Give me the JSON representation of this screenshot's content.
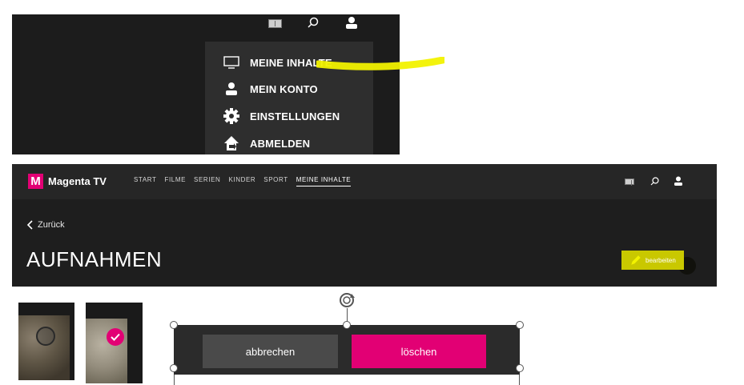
{
  "dropdown_panel": {
    "header_icons": [
      "language-flag-icon",
      "search-icon",
      "user-icon"
    ],
    "menu": [
      {
        "label": "MEINE INHALTE",
        "icon": "tv-icon"
      },
      {
        "label": "MEIN KONTO",
        "icon": "user-icon"
      },
      {
        "label": "EINSTELLUNGEN",
        "icon": "gear-icon"
      },
      {
        "label": "ABMELDEN",
        "icon": "home-logout-icon"
      }
    ],
    "highlight_color": "#f2f200"
  },
  "header": {
    "logo_letter": "M",
    "brand": "Magenta TV",
    "nav": [
      "START",
      "FILME",
      "SERIEN",
      "KINDER",
      "SPORT",
      "MEINE INHALTE"
    ],
    "active_nav": "MEINE INHALTE",
    "icons": [
      "language-flag-icon",
      "search-icon",
      "user-icon"
    ]
  },
  "page": {
    "back_label": "Zurück",
    "title": "AUFNAHMEN",
    "edit_label": "bearbeiten"
  },
  "confirm_bar": {
    "cancel_label": "abbrechen",
    "delete_label": "löschen"
  },
  "colors": {
    "magenta": "#e20074",
    "edit_button": "#c9c800",
    "panel_bg": "#1e1e1e"
  }
}
